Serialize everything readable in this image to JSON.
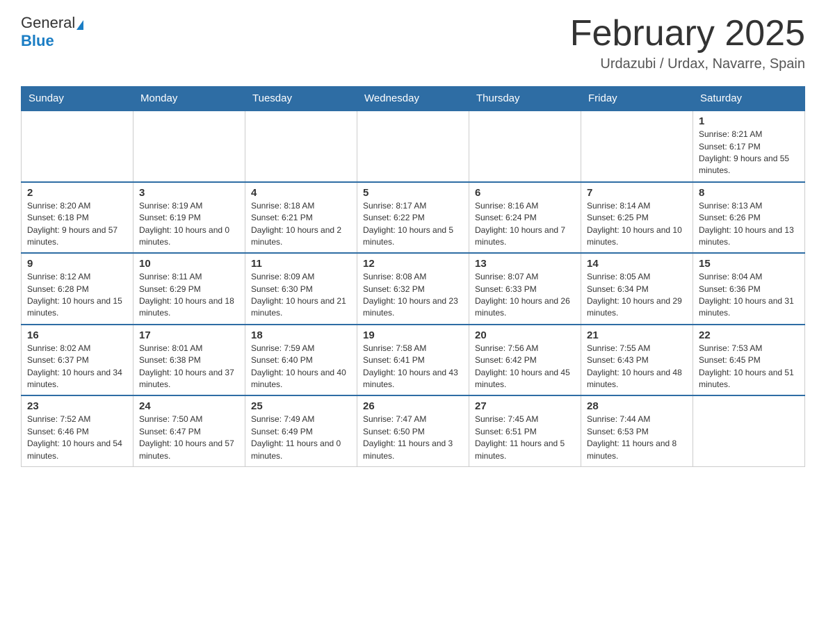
{
  "header": {
    "logo_text1": "General",
    "logo_text2": "Blue",
    "month_title": "February 2025",
    "subtitle": "Urdazubi / Urdax, Navarre, Spain"
  },
  "weekdays": [
    "Sunday",
    "Monday",
    "Tuesday",
    "Wednesday",
    "Thursday",
    "Friday",
    "Saturday"
  ],
  "weeks": [
    [
      {
        "day": "",
        "info": ""
      },
      {
        "day": "",
        "info": ""
      },
      {
        "day": "",
        "info": ""
      },
      {
        "day": "",
        "info": ""
      },
      {
        "day": "",
        "info": ""
      },
      {
        "day": "",
        "info": ""
      },
      {
        "day": "1",
        "info": "Sunrise: 8:21 AM\nSunset: 6:17 PM\nDaylight: 9 hours and 55 minutes."
      }
    ],
    [
      {
        "day": "2",
        "info": "Sunrise: 8:20 AM\nSunset: 6:18 PM\nDaylight: 9 hours and 57 minutes."
      },
      {
        "day": "3",
        "info": "Sunrise: 8:19 AM\nSunset: 6:19 PM\nDaylight: 10 hours and 0 minutes."
      },
      {
        "day": "4",
        "info": "Sunrise: 8:18 AM\nSunset: 6:21 PM\nDaylight: 10 hours and 2 minutes."
      },
      {
        "day": "5",
        "info": "Sunrise: 8:17 AM\nSunset: 6:22 PM\nDaylight: 10 hours and 5 minutes."
      },
      {
        "day": "6",
        "info": "Sunrise: 8:16 AM\nSunset: 6:24 PM\nDaylight: 10 hours and 7 minutes."
      },
      {
        "day": "7",
        "info": "Sunrise: 8:14 AM\nSunset: 6:25 PM\nDaylight: 10 hours and 10 minutes."
      },
      {
        "day": "8",
        "info": "Sunrise: 8:13 AM\nSunset: 6:26 PM\nDaylight: 10 hours and 13 minutes."
      }
    ],
    [
      {
        "day": "9",
        "info": "Sunrise: 8:12 AM\nSunset: 6:28 PM\nDaylight: 10 hours and 15 minutes."
      },
      {
        "day": "10",
        "info": "Sunrise: 8:11 AM\nSunset: 6:29 PM\nDaylight: 10 hours and 18 minutes."
      },
      {
        "day": "11",
        "info": "Sunrise: 8:09 AM\nSunset: 6:30 PM\nDaylight: 10 hours and 21 minutes."
      },
      {
        "day": "12",
        "info": "Sunrise: 8:08 AM\nSunset: 6:32 PM\nDaylight: 10 hours and 23 minutes."
      },
      {
        "day": "13",
        "info": "Sunrise: 8:07 AM\nSunset: 6:33 PM\nDaylight: 10 hours and 26 minutes."
      },
      {
        "day": "14",
        "info": "Sunrise: 8:05 AM\nSunset: 6:34 PM\nDaylight: 10 hours and 29 minutes."
      },
      {
        "day": "15",
        "info": "Sunrise: 8:04 AM\nSunset: 6:36 PM\nDaylight: 10 hours and 31 minutes."
      }
    ],
    [
      {
        "day": "16",
        "info": "Sunrise: 8:02 AM\nSunset: 6:37 PM\nDaylight: 10 hours and 34 minutes."
      },
      {
        "day": "17",
        "info": "Sunrise: 8:01 AM\nSunset: 6:38 PM\nDaylight: 10 hours and 37 minutes."
      },
      {
        "day": "18",
        "info": "Sunrise: 7:59 AM\nSunset: 6:40 PM\nDaylight: 10 hours and 40 minutes."
      },
      {
        "day": "19",
        "info": "Sunrise: 7:58 AM\nSunset: 6:41 PM\nDaylight: 10 hours and 43 minutes."
      },
      {
        "day": "20",
        "info": "Sunrise: 7:56 AM\nSunset: 6:42 PM\nDaylight: 10 hours and 45 minutes."
      },
      {
        "day": "21",
        "info": "Sunrise: 7:55 AM\nSunset: 6:43 PM\nDaylight: 10 hours and 48 minutes."
      },
      {
        "day": "22",
        "info": "Sunrise: 7:53 AM\nSunset: 6:45 PM\nDaylight: 10 hours and 51 minutes."
      }
    ],
    [
      {
        "day": "23",
        "info": "Sunrise: 7:52 AM\nSunset: 6:46 PM\nDaylight: 10 hours and 54 minutes."
      },
      {
        "day": "24",
        "info": "Sunrise: 7:50 AM\nSunset: 6:47 PM\nDaylight: 10 hours and 57 minutes."
      },
      {
        "day": "25",
        "info": "Sunrise: 7:49 AM\nSunset: 6:49 PM\nDaylight: 11 hours and 0 minutes."
      },
      {
        "day": "26",
        "info": "Sunrise: 7:47 AM\nSunset: 6:50 PM\nDaylight: 11 hours and 3 minutes."
      },
      {
        "day": "27",
        "info": "Sunrise: 7:45 AM\nSunset: 6:51 PM\nDaylight: 11 hours and 5 minutes."
      },
      {
        "day": "28",
        "info": "Sunrise: 7:44 AM\nSunset: 6:53 PM\nDaylight: 11 hours and 8 minutes."
      },
      {
        "day": "",
        "info": ""
      }
    ]
  ]
}
